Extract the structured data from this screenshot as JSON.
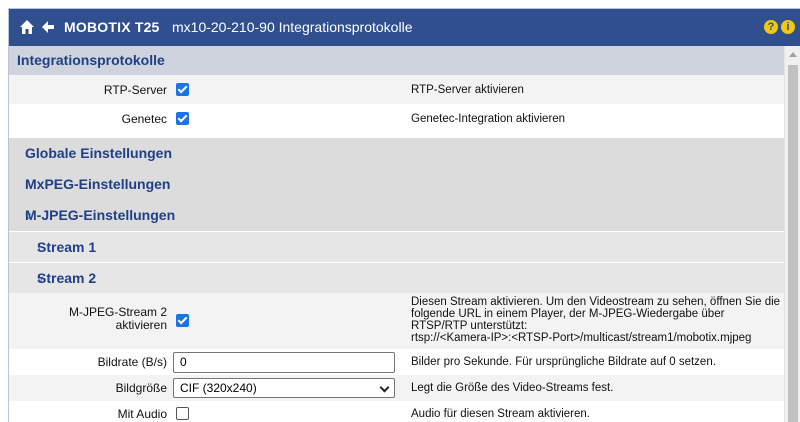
{
  "header": {
    "brand": "MOBOTIX T25",
    "page": "mx10-20-210-90 Integrationsprotokolle",
    "help_labels": [
      "?",
      "i"
    ],
    "icons": [
      "home-icon",
      "back-arrow-icon",
      "help-icon",
      "info-icon"
    ]
  },
  "section": {
    "title": "Integrationsprotokolle"
  },
  "settings": [
    {
      "label": "RTP-Server",
      "checked": true,
      "description": "RTP-Server aktivieren"
    },
    {
      "label": "Genetec",
      "checked": true,
      "description": "Genetec-Integration aktivieren"
    }
  ],
  "groups": [
    {
      "title": "Globale Einstellungen",
      "expanded": false
    },
    {
      "title": "MxPEG-Einstellungen",
      "expanded": false
    },
    {
      "title": "M-JPEG-Einstellungen",
      "expanded": true
    }
  ],
  "streams": [
    {
      "title": "Stream 1",
      "expanded": false
    },
    {
      "title": "Stream 2",
      "expanded": true
    }
  ],
  "stream2": {
    "enable_label": "M-JPEG-Stream 2 aktivieren",
    "enable_checked": true,
    "enable_description": "Diesen Stream aktivieren. Um den Videostream zu sehen, öffnen Sie die folgende URL in einem Player, der M-JPEG-Wiedergabe über RTSP/RTP unterstützt:",
    "enable_url": "rtsp://<Kamera-IP>:<RTSP-Port>/multicast/stream1/mobotix.mjpeg",
    "bitrate_label": "Bildrate (B/s)",
    "bitrate_value": "0",
    "bitrate_description": "Bilder pro Sekunde. Für ursprüngliche Bildrate auf 0 setzen.",
    "size_label": "Bildgröße",
    "size_value": "CIF (320x240)",
    "size_description": "Legt die Größe des Video-Streams fest.",
    "audio_label": "Mit Audio",
    "audio_checked": false,
    "audio_description": "Audio für diesen Stream aktivieren."
  },
  "colors": {
    "titlebar": "#2f4f8f",
    "accent_text": "#1f3f86",
    "checkbox": "#1a73e8",
    "help_badge": "#f2c80f"
  }
}
